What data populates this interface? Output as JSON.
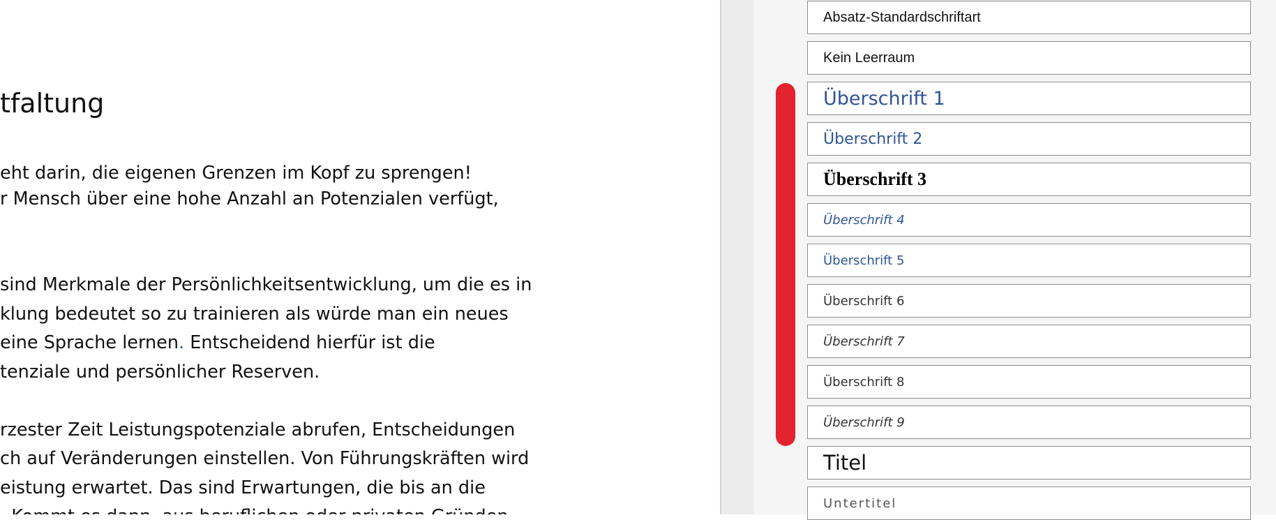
{
  "document": {
    "heading": "tfaltung",
    "lines": [
      "eht darin, die eigenen Grenzen im Kopf zu sprengen!",
      "r Mensch über eine hohe Anzahl an Potenzialen verfügt,",
      " sind Merkmale der Persönlichkeitsentwicklung, um die es in",
      "klung bedeutet so zu trainieren als würde man ein neues",
      "eine Sprache lernen",
      "tenziale und persönlicher Reserven.",
      "rzester Zeit Leistungspotenziale abrufen, Entscheidungen",
      "ch auf Veränderungen einstellen. Von Führungskräften wird",
      "eistung erwartet. Das sind Erwartungen, die bis an die",
      ". Kommt es dann, aus beruflichen oder privaten Gründen"
    ],
    "line5_accent": ".",
    "line5_rest": " Entscheidend hierfür ist die"
  },
  "styles_pane": {
    "items": [
      {
        "label": "Absatz-Standardschriftart"
      },
      {
        "label": "Kein Leerraum"
      },
      {
        "label": "Überschrift 1"
      },
      {
        "label": "Überschrift 2"
      },
      {
        "label": "Überschrift 3"
      },
      {
        "label": "Überschrift 4"
      },
      {
        "label": "Überschrift 5"
      },
      {
        "label": "Überschrift 6"
      },
      {
        "label": "Überschrift 7"
      },
      {
        "label": "Überschrift 8"
      },
      {
        "label": "Überschrift 9"
      },
      {
        "label": "Titel"
      },
      {
        "label": "Untertitel"
      }
    ],
    "scrollbar_color": "#e3232e",
    "heading_color": "#2f5496"
  }
}
